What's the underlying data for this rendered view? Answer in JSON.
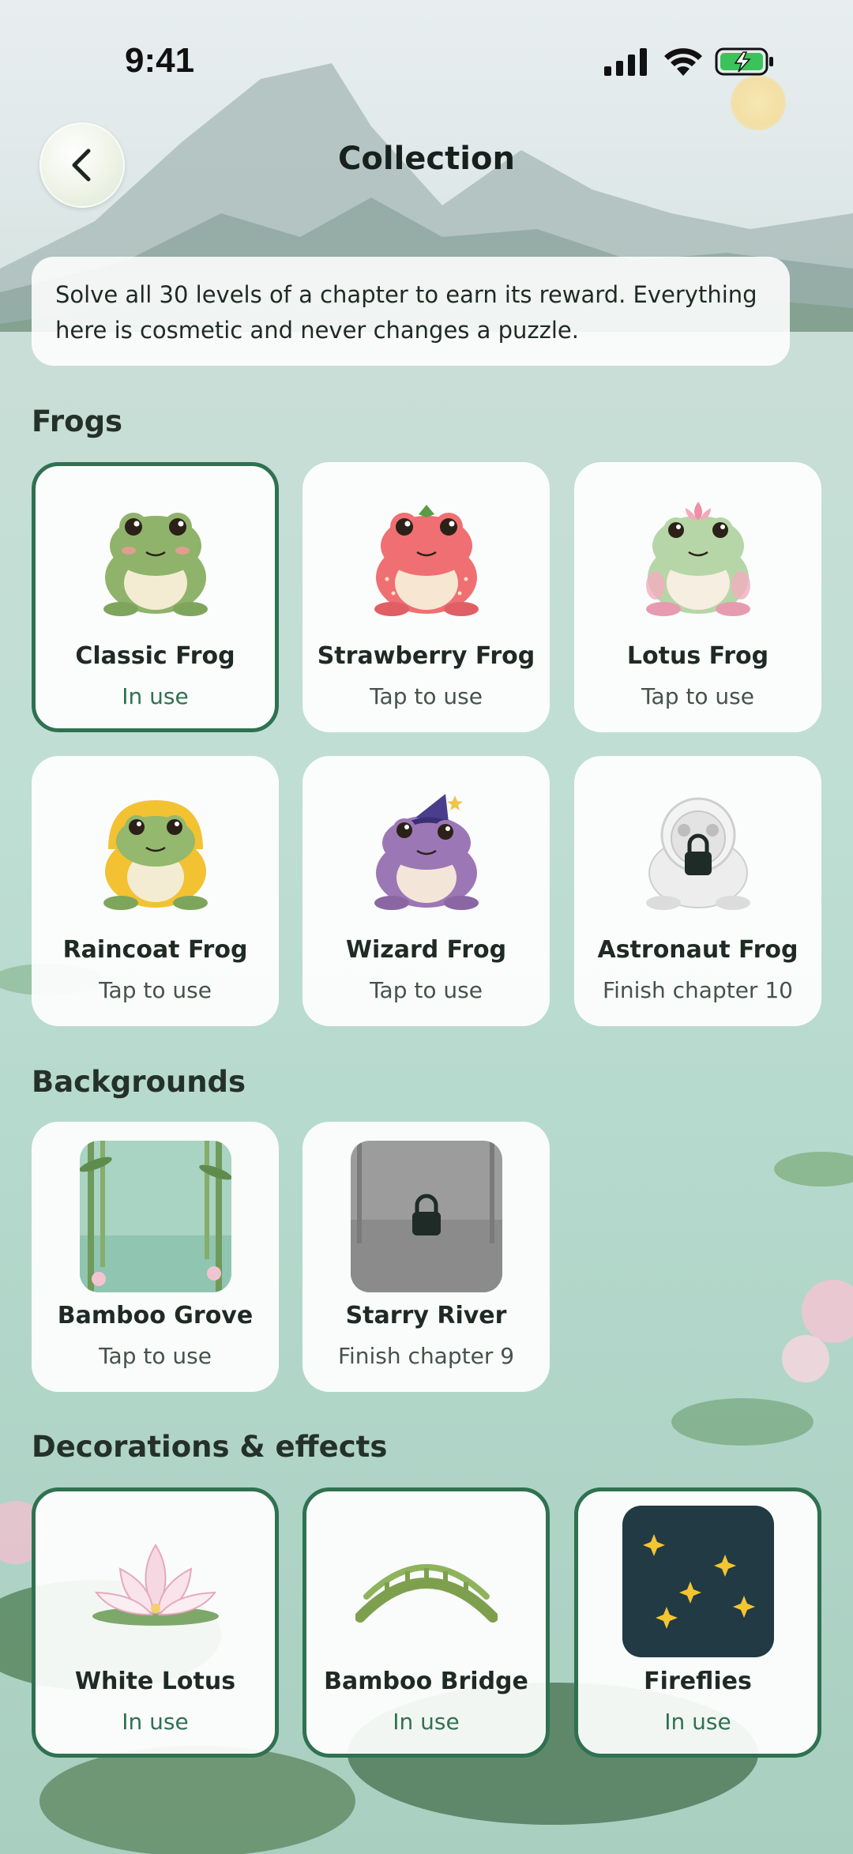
{
  "status": {
    "time": "9:41"
  },
  "header": {
    "title": "Collection",
    "back_icon": "chevron-left-icon"
  },
  "info": {
    "text": "Solve all 30 levels of a chapter to earn its reward. Everything here is cosmetic and never changes a puzzle."
  },
  "sections": {
    "frogs": {
      "title": "Frogs",
      "items": [
        {
          "name": "Classic Frog",
          "status": "In use",
          "color": "#8fb36a"
        },
        {
          "name": "Strawberry Frog",
          "status": "Tap to use",
          "color": "#ef6f72"
        },
        {
          "name": "Lotus Frog",
          "status": "Tap to use",
          "color": "#b7d6a8"
        },
        {
          "name": "Raincoat Frog",
          "status": "Tap to use",
          "color": "#f2c232"
        },
        {
          "name": "Wizard Frog",
          "status": "Tap to use",
          "color": "#9c77b6"
        },
        {
          "name": "Astronaut Frog",
          "status": "Finish chapter 10",
          "color": "#e6e6e6"
        }
      ]
    },
    "backgrounds": {
      "title": "Backgrounds",
      "items": [
        {
          "name": "Bamboo Grove",
          "status": "Tap to use"
        },
        {
          "name": "Starry River",
          "status": "Finish chapter 9"
        }
      ]
    },
    "decorations": {
      "title": "Decorations & effects",
      "items": [
        {
          "name": "White Lotus",
          "status": "In use"
        },
        {
          "name": "Bamboo Bridge",
          "status": "In use"
        },
        {
          "name": "Fireflies",
          "status": "In use"
        }
      ]
    }
  },
  "colors": {
    "accent": "#2f7150",
    "card": "#ffffff",
    "lock": "#1e2b27",
    "night": "#213a44"
  }
}
